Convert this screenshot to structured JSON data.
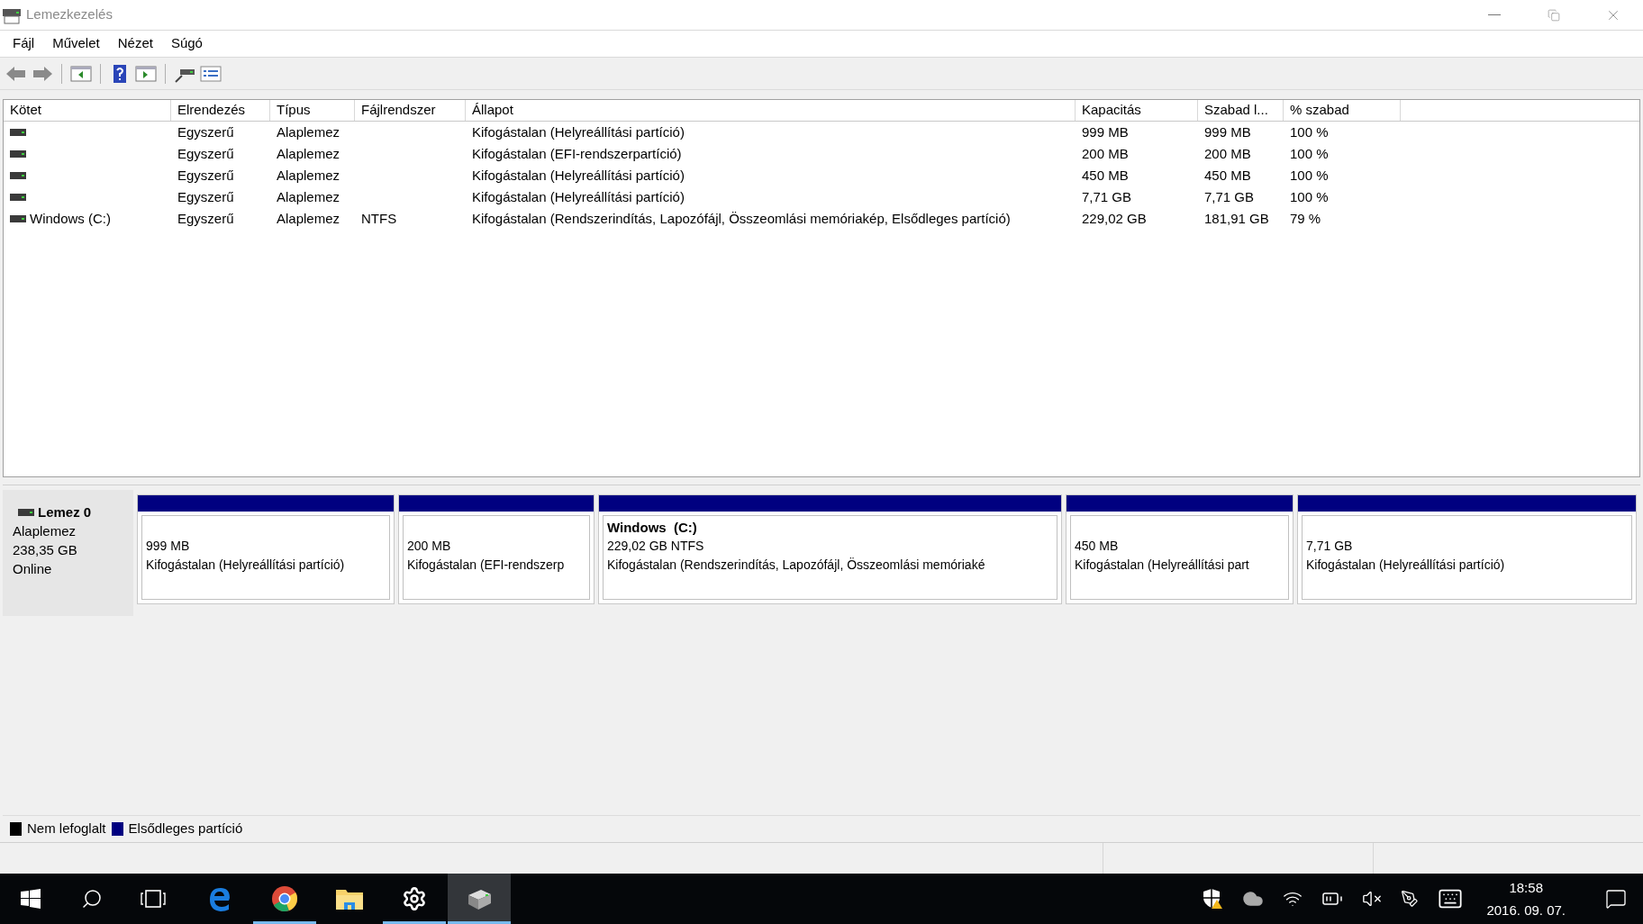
{
  "window": {
    "title": "Lemezkezelés"
  },
  "menu": [
    "Fájl",
    "Művelet",
    "Nézet",
    "Súgó"
  ],
  "toolbar": [
    {
      "kind": "back"
    },
    {
      "kind": "forward"
    },
    {
      "kind": "sep"
    },
    {
      "kind": "tree"
    },
    {
      "kind": "sep"
    },
    {
      "kind": "help"
    },
    {
      "kind": "pane"
    },
    {
      "kind": "sep"
    },
    {
      "kind": "connect"
    },
    {
      "kind": "props"
    }
  ],
  "table": {
    "columns": [
      "Kötet",
      "Elrendezés",
      "Típus",
      "Fájlrendszer",
      "Állapot",
      "Kapacitás",
      "Szabad l...",
      "% szabad"
    ],
    "rows": [
      {
        "volume": "",
        "layout": "Egyszerű",
        "type": "Alaplemez",
        "fs": "",
        "status": "Kifogástalan (Helyreállítási partíció)",
        "capacity": "999 MB",
        "free": "999 MB",
        "percent": "100 %"
      },
      {
        "volume": "",
        "layout": "Egyszerű",
        "type": "Alaplemez",
        "fs": "",
        "status": "Kifogástalan (EFI-rendszerpartíció)",
        "capacity": "200 MB",
        "free": "200 MB",
        "percent": "100 %"
      },
      {
        "volume": "",
        "layout": "Egyszerű",
        "type": "Alaplemez",
        "fs": "",
        "status": "Kifogástalan (Helyreállítási partíció)",
        "capacity": "450 MB",
        "free": "450 MB",
        "percent": "100 %"
      },
      {
        "volume": "",
        "layout": "Egyszerű",
        "type": "Alaplemez",
        "fs": "",
        "status": "Kifogástalan (Helyreállítási partíció)",
        "capacity": "7,71 GB",
        "free": "7,71 GB",
        "percent": "100 %"
      },
      {
        "volume": "Windows (C:)",
        "layout": "Egyszerű",
        "type": "Alaplemez",
        "fs": "NTFS",
        "status": "Kifogástalan (Rendszerindítás, Lapozófájl, Összeomlási memóriakép, Elsődleges partíció)",
        "capacity": "229,02 GB",
        "free": "181,91 GB",
        "percent": "79 %"
      }
    ]
  },
  "disk": {
    "name": "Lemez 0",
    "type": "Alaplemez",
    "size": "238,35 GB",
    "state": "Online",
    "partitions": [
      {
        "size": "999 MB",
        "status": "Kifogástalan (Helyreállítási partíció)"
      },
      {
        "size": "200 MB",
        "status": "Kifogástalan (EFI-rendszerp"
      },
      {
        "name": "Windows  (C:)",
        "size": "229,02 GB NTFS",
        "status": "Kifogástalan (Rendszerindítás, Lapozófájl, Összeomlási memóriaké"
      },
      {
        "size": "450 MB",
        "status": "Kifogástalan (Helyreállítási part"
      },
      {
        "size": "7,71 GB",
        "status": "Kifogástalan (Helyreállítási partíció)"
      }
    ]
  },
  "legend": [
    {
      "label": "Nem lefoglalt",
      "color": "#000000"
    },
    {
      "label": "Elsődleges partíció",
      "color": "#000080"
    }
  ],
  "taskbar": {
    "buttons": [
      {
        "kind": "start"
      },
      {
        "kind": "search"
      },
      {
        "kind": "taskview"
      }
    ],
    "apps": [
      {
        "kind": "edge",
        "running": false,
        "selected": false
      },
      {
        "kind": "chrome",
        "running": true,
        "selected": false
      },
      {
        "kind": "explorer",
        "running": false,
        "selected": false
      },
      {
        "kind": "settings",
        "running": true,
        "selected": false
      },
      {
        "kind": "disk",
        "running": true,
        "selected": true
      }
    ],
    "tray": [
      {
        "kind": "shield"
      },
      {
        "kind": "cloud"
      },
      {
        "kind": "wifi"
      },
      {
        "kind": "battery"
      },
      {
        "kind": "mute"
      },
      {
        "kind": "pen"
      },
      {
        "kind": "keyboard"
      }
    ],
    "time": "18:58",
    "date": "2016. 09. 07."
  }
}
